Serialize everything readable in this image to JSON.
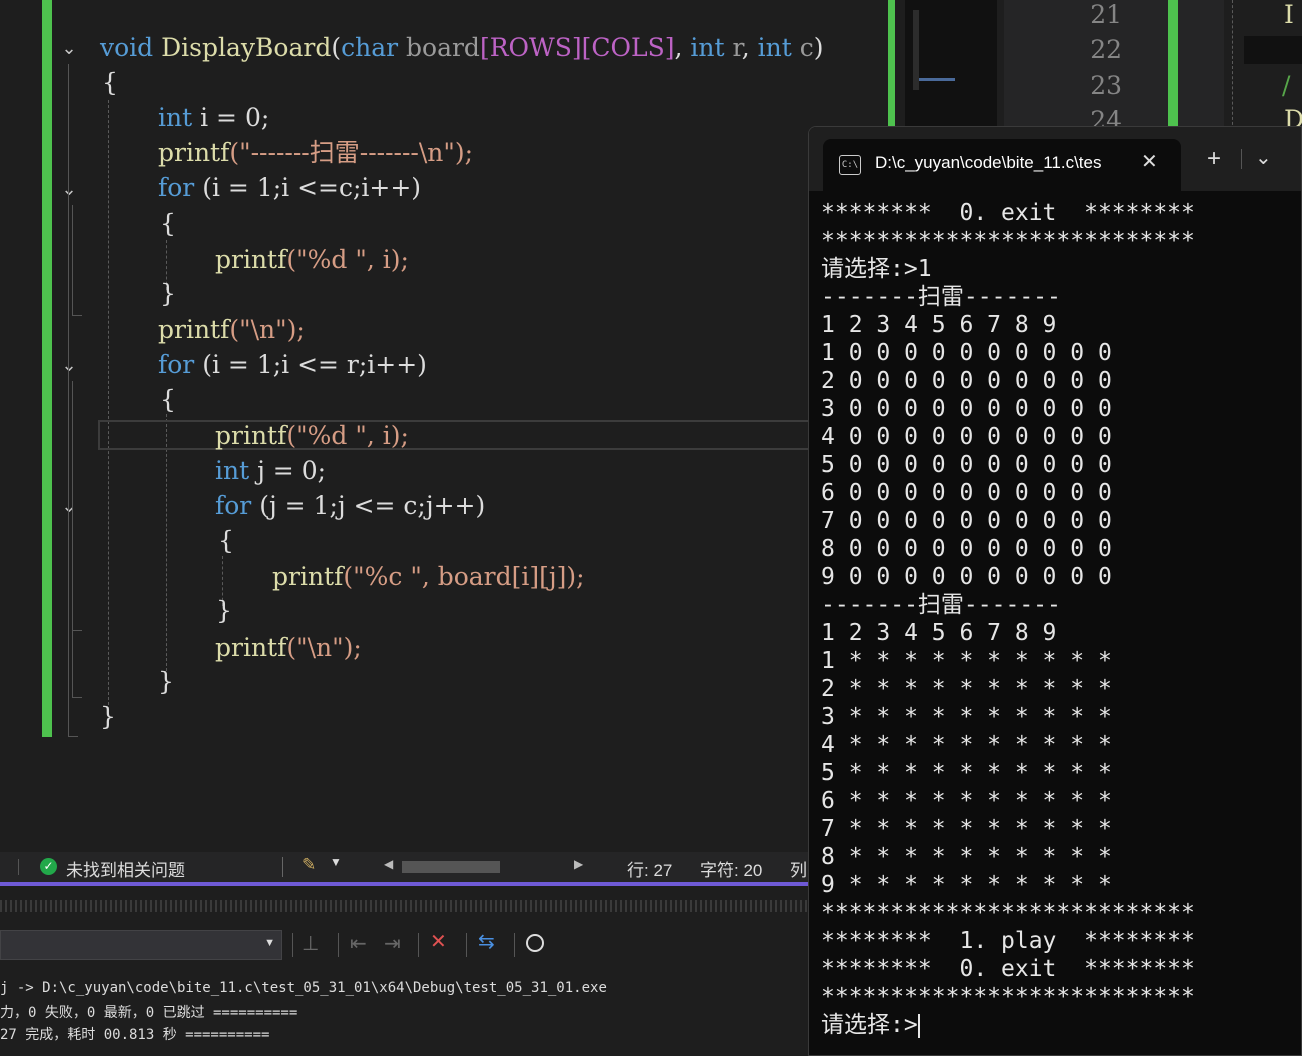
{
  "editor": {
    "function_signature": {
      "return_type": "void",
      "name": "DisplayBoard",
      "open_paren": "(",
      "p1_type": "char",
      "p1_name": "board",
      "p1_dims": "[ROWS][COLS]",
      "sep1": ", ",
      "p2_type": "int",
      "p2_name": "r",
      "sep2": ", ",
      "p3_type": "int",
      "p3_name": "c",
      "close_paren": ")"
    },
    "lines": {
      "open_brace_fn": "{",
      "l_int_i_kw": "int",
      "l_int_i_rest": " i = 0;",
      "l_printf_title_fn": "printf",
      "l_printf_title_str": "(\"-------扫雷-------\\n\");",
      "l_for1_kw": "for",
      "l_for1_rest": " (i = 1;i <=c;i++)",
      "l_brace1_open": "{",
      "l_printf_d_fn": "printf",
      "l_printf_d_rest": "(\"%d \", i);",
      "l_brace1_close": "}",
      "l_printf_n_fn": "printf",
      "l_printf_n_rest": "(\"\\n\");",
      "l_for2_kw": "for",
      "l_for2_rest": " (i = 1;i <= r;i++)",
      "l_brace2_open": "{",
      "l_printf_d2_fn": "printf",
      "l_printf_d2_rest": "(\"%d \", i);",
      "l_int_j_kw": "int",
      "l_int_j_rest": " j = 0;",
      "l_for3_kw": "for",
      "l_for3_rest": " (j = 1;j <= c;j++)",
      "l_brace3_open": "{",
      "l_printf_c_fn": "printf",
      "l_printf_c_rest": "(\"%c \", board[i][j]);",
      "l_brace3_close": "}",
      "l_printf_n2_fn": "printf",
      "l_printf_n2_rest": "(\"\\n\");",
      "l_brace2_close": "}",
      "close_brace_fn": "}"
    }
  },
  "split": {
    "line_numbers": [
      "21",
      "22",
      "23",
      "24"
    ],
    "code_fragments": [
      "I",
      "",
      "/",
      "D"
    ]
  },
  "statusbar": {
    "issues": "未找到相关问题",
    "line": "行: 27",
    "char": "字符: 20",
    "col": "列"
  },
  "output": {
    "lines": [
      "j -> D:\\c_yuyan\\code\\bite_11.c\\test_05_31_01\\x64\\Debug\\test_05_31_01.exe",
      "力，0 失败，0 最新，0 已跳过 ==========",
      "27 完成，耗时 00.813 秒 =========="
    ]
  },
  "terminal": {
    "tab_title": "D:\\c_yuyan\\code\\bite_11.c\\tes",
    "lines": [
      "********  0. exit  ********",
      "***************************",
      "请选择:>1",
      "-------扫雷-------",
      "1 2 3 4 5 6 7 8 9",
      "1 0 0 0 0 0 0 0 0 0 0",
      "2 0 0 0 0 0 0 0 0 0 0",
      "3 0 0 0 0 0 0 0 0 0 0",
      "4 0 0 0 0 0 0 0 0 0 0",
      "5 0 0 0 0 0 0 0 0 0 0",
      "6 0 0 0 0 0 0 0 0 0 0",
      "7 0 0 0 0 0 0 0 0 0 0",
      "8 0 0 0 0 0 0 0 0 0 0",
      "9 0 0 0 0 0 0 0 0 0 0",
      "-------扫雷-------",
      "1 2 3 4 5 6 7 8 9",
      "1 * * * * * * * * * *",
      "2 * * * * * * * * * *",
      "3 * * * * * * * * * *",
      "4 * * * * * * * * * *",
      "5 * * * * * * * * * *",
      "6 * * * * * * * * * *",
      "7 * * * * * * * * * *",
      "8 * * * * * * * * * *",
      "9 * * * * * * * * * *",
      "***************************",
      "********  1. play  ********",
      "********  0. exit  ********",
      "***************************",
      "请选择:>"
    ]
  },
  "icons": {
    "fold": "chevron-down-icon",
    "issues": "check-circle-icon",
    "new_tab": "plus-icon",
    "tab_dropdown": "chevron-down-icon",
    "close_tab": "close-icon"
  },
  "colors": {
    "change_bar": "#4ec24e",
    "status_accent": "#6f5ad6",
    "ok_green": "#22a84a"
  }
}
